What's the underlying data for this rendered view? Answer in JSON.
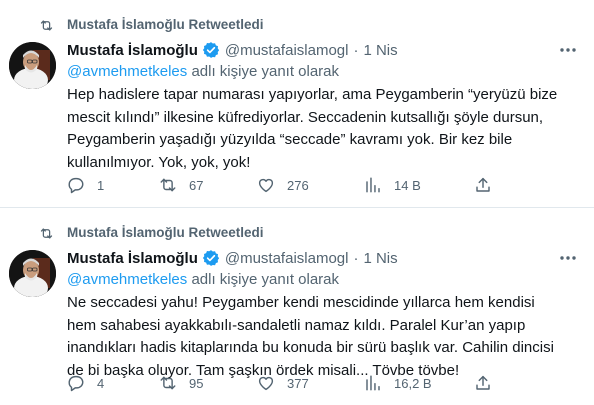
{
  "tweets": [
    {
      "retweet_label": "Mustafa İslamoğlu Retweetledi",
      "author_name": "Mustafa İslamoğlu",
      "handle": "@mustafaislamogl",
      "separator": "·",
      "date": "1 Nis",
      "reply_mention": "@avmehmetkeles",
      "reply_suffix": " adlı kişiye yanıt olarak",
      "text": "Hep hadislere tapar numarası yapıyorlar, ama Peygamberin “yeryüzü bize\nmescit kılındı” ilkesine küfrediyorlar. Seccadenin kutsallığı şöyle dursun,\nPeygamberin yaşadığı yüzyılda “seccade” kavramı yok. Bir kez bile\nkullanılmıyor. Yok, yok, yok!",
      "replies": "1",
      "retweets": "67",
      "likes": "276",
      "views": "14 B"
    },
    {
      "retweet_label": "Mustafa İslamoğlu Retweetledi",
      "author_name": "Mustafa İslamoğlu",
      "handle": "@mustafaislamogl",
      "separator": "·",
      "date": "1 Nis",
      "reply_mention": "@avmehmetkeles",
      "reply_suffix": " adlı kişiye yanıt olarak",
      "text": "Ne seccadesi yahu! Peygamber kendi mescidinde yıllarca hem kendisi\nhem sahabesi ayakkabılı-sandaletli namaz kıldı. Paralel Kur’an yapıp\ninandıkları hadis kitaplarında bu konuda bir sürü başlık var. Cahilin dincisi\nde bi başka oluyor. Tam şaşkın ördek misali... Tövbe tövbe!",
      "replies": "4",
      "retweets": "95",
      "likes": "377",
      "views": "16,2 B"
    }
  ],
  "icons": {
    "retweet": "retweet-icon",
    "verified": "verified-badge-icon",
    "more": "more-icon",
    "reply": "reply-icon",
    "like": "heart-icon",
    "views": "views-icon",
    "share": "share-icon"
  },
  "colors": {
    "text": "#0f1419",
    "secondary": "#536471",
    "link": "#1d9bf0",
    "verified": "#1d9bf0",
    "border": "#e1e8ed"
  }
}
